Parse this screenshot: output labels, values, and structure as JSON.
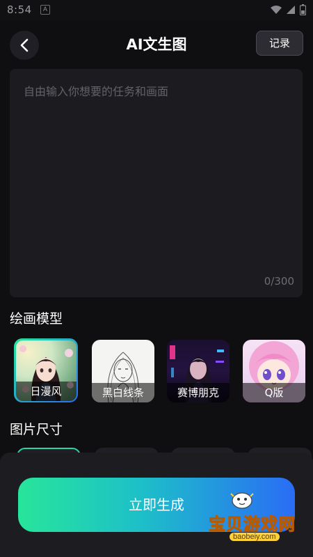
{
  "status_bar": {
    "time": "8:54",
    "notification_icon": "A"
  },
  "header": {
    "title": "AI文生图",
    "back_icon": "chevron-left-icon",
    "record_label": "记录"
  },
  "prompt": {
    "placeholder": "自由输入你想要的任务和画面",
    "value": "",
    "counter": "0/300"
  },
  "models": {
    "title": "绘画模型",
    "items": [
      {
        "label": "日漫风",
        "selected": true
      },
      {
        "label": "黑白线条",
        "selected": false
      },
      {
        "label": "赛博朋克",
        "selected": false
      },
      {
        "label": "Q版",
        "selected": false
      }
    ]
  },
  "sizes": {
    "title": "图片尺寸"
  },
  "generate": {
    "label": "立即生成"
  },
  "watermark": {
    "text": "宝贝游戏网",
    "url": "baobeiy.com"
  },
  "colors": {
    "background": "#0f0f11",
    "panel": "#1b1b20",
    "accent_start": "#27e59b",
    "accent_end": "#2a6cf5"
  }
}
